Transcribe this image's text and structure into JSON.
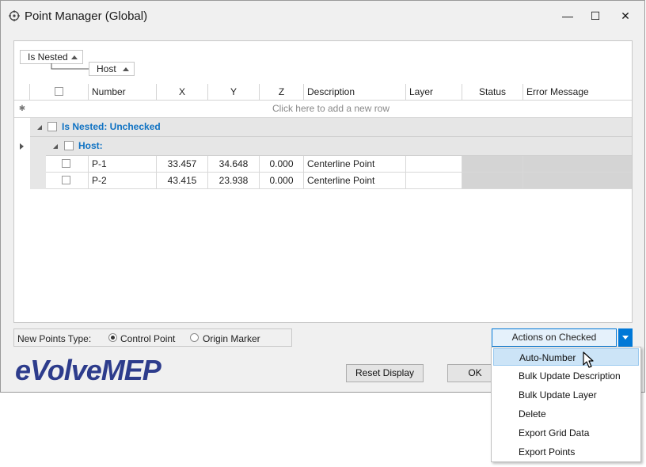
{
  "window": {
    "title": "Point Manager (Global)",
    "controls": {
      "minimize": "—",
      "maximize": "☐",
      "close": "✕"
    }
  },
  "grouping": {
    "chips": [
      "Is Nested",
      "Host"
    ]
  },
  "grid": {
    "columns": [
      "Number",
      "X",
      "Y",
      "Z",
      "Description",
      "Layer",
      "Status",
      "Error Message"
    ],
    "new_row_text": "Click here to add a new row",
    "new_row_icon": "✱",
    "group1_label": "Is Nested: Unchecked",
    "group2_label": "Host:",
    "rows": [
      {
        "number": "P-1",
        "x": "33.457",
        "y": "34.648",
        "z": "0.000",
        "description": "Centerline Point",
        "layer": "",
        "status": "",
        "error": ""
      },
      {
        "number": "P-2",
        "x": "43.415",
        "y": "23.938",
        "z": "0.000",
        "description": "Centerline Point",
        "layer": "",
        "status": "",
        "error": ""
      }
    ]
  },
  "new_points": {
    "label": "New Points Type:",
    "options": [
      "Control Point",
      "Origin Marker"
    ],
    "selected": "Control Point"
  },
  "buttons": {
    "reset_display": "Reset Display",
    "ok": "OK",
    "actions_on_checked": "Actions on Checked"
  },
  "actions_menu": {
    "items": [
      "Auto-Number",
      "Bulk Update Description",
      "Bulk Update Layer",
      "Delete",
      "Export Grid Data",
      "Export Points"
    ],
    "highlighted": "Auto-Number"
  },
  "brand": {
    "logo_text": "eVolveMEP",
    "logo_color": "#2d3c8c"
  },
  "colors": {
    "accent": "#0078d7",
    "group_text": "#0f72c3",
    "menu_highlight": "#cce4f7"
  }
}
